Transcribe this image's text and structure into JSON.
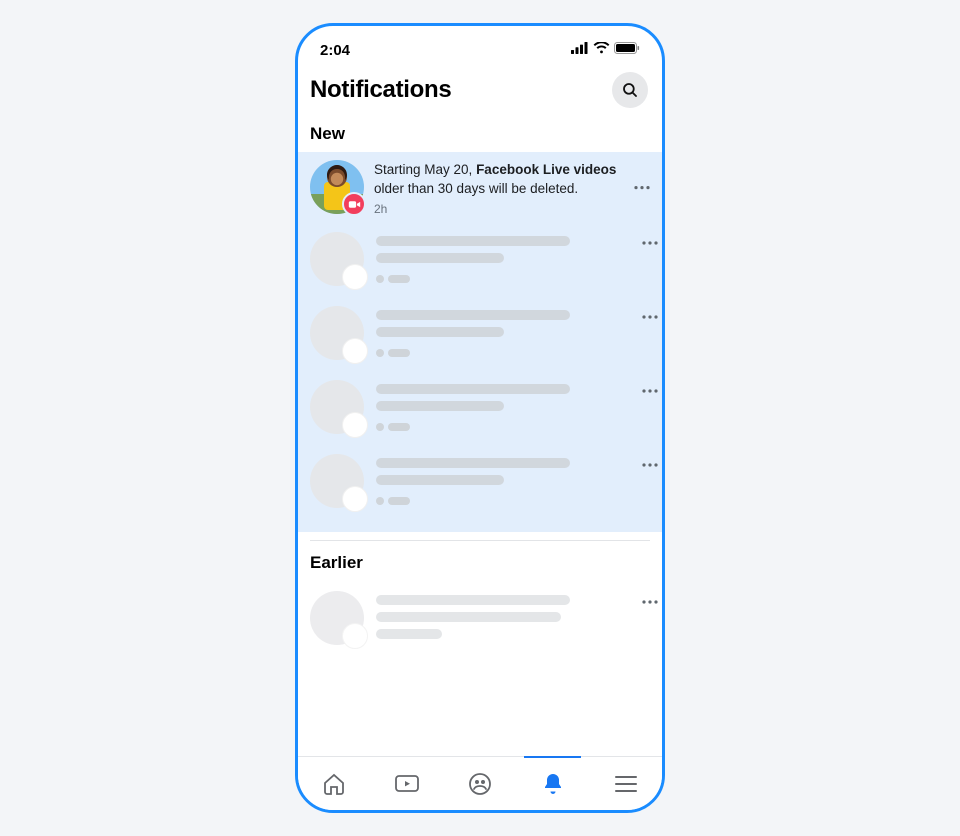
{
  "status": {
    "time": "2:04"
  },
  "header": {
    "title": "Notifications"
  },
  "sections": {
    "new": "New",
    "earlier": "Earlier"
  },
  "notification": {
    "text_prefix": "Starting May 20, ",
    "text_bold": "Facebook Live videos",
    "text_suffix": " older than 30 days will be deleted.",
    "time": "2h"
  },
  "icons": {
    "search": "search-icon",
    "more": "more-icon",
    "live_video": "live-video-icon",
    "home": "home-icon",
    "watch": "watch-icon",
    "groups": "groups-icon",
    "notifications": "bell-icon",
    "menu": "hamburger-icon",
    "signal": "cellular-icon",
    "wifi": "wifi-icon",
    "battery": "battery-icon"
  },
  "tabs": {
    "active": "notifications"
  }
}
